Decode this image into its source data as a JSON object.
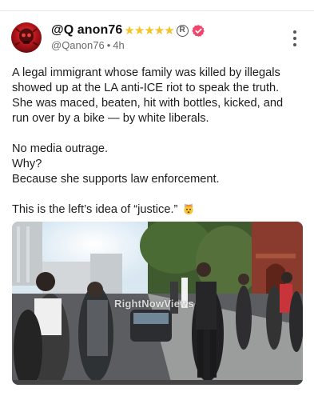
{
  "post": {
    "author": {
      "display_name": "@Q anon76",
      "badges": "★★★★★",
      "registered_mark": "R",
      "handle": "@Qanon76",
      "separator": "•",
      "time": "4h"
    },
    "text": {
      "line1": "A legal immigrant whose family was killed by illegals",
      "line2": "showed up at the LA anti-ICE riot to speak the truth.",
      "line3": "She was maced, beaten, hit with bottles, kicked, and",
      "line4": "run over by a bike — by white liberals.",
      "line5": "No media outrage.",
      "line6": "Why?",
      "line7": "Because she supports law enforcement.",
      "line8": "This is the left’s idea of “justice.”"
    },
    "media": {
      "watermark": "RightNowViews"
    }
  },
  "icons": {
    "avatar": "red-skull-avatar",
    "verified": "verified-badge-icon",
    "more": "more-options-icon",
    "emoji": "exploding-head-emoji"
  },
  "colors": {
    "verified": "#f0466b",
    "stars": "#f5c227",
    "text": "#1c1c1e",
    "muted": "#6b6b6b"
  }
}
